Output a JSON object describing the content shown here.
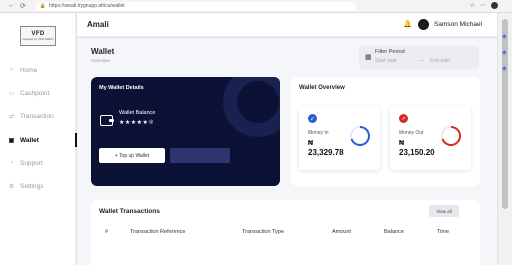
{
  "browser": {
    "url": "https://amali.trygnupp.africa/wallet"
  },
  "logo": {
    "line1": "VFD",
    "line2": "Opened by VFD AMALI"
  },
  "sidebar": {
    "items": [
      {
        "label": "Home",
        "icon": "home-icon"
      },
      {
        "label": "Cashpoint",
        "icon": "cashpoint-icon"
      },
      {
        "label": "Transaction",
        "icon": "transaction-icon"
      },
      {
        "label": "Wallet",
        "icon": "wallet-icon",
        "active": true
      },
      {
        "label": "Support",
        "icon": "support-icon"
      },
      {
        "label": "Settings",
        "icon": "gear-icon"
      }
    ]
  },
  "topbar": {
    "app_name": "Amali",
    "user_name": "Samson Michael"
  },
  "page": {
    "title": "Wallet",
    "breadcrumb": "Overview"
  },
  "filter": {
    "label": "Filter Period",
    "start_placeholder": "Start date",
    "end_placeholder": "End date"
  },
  "wallet_details": {
    "title": "My Wallet Details",
    "balance_label": "Wallet Balance",
    "balance_masked": "★★★★★",
    "topup_label": "+ Top up Wallet"
  },
  "overview": {
    "title": "Wallet Overview",
    "money_in": {
      "label": "Money In",
      "currency": "₦",
      "amount": "23,329.78",
      "color": "#2f5bd3"
    },
    "money_out": {
      "label": "Money Out",
      "currency": "₦",
      "amount": "23,150.20",
      "color": "#d42b2b"
    }
  },
  "transactions": {
    "title": "Wallet Transactions",
    "view_all": "View all",
    "columns": [
      "#",
      "Transaction Reference",
      "Transaction Type",
      "Amount",
      "Balance",
      "Time"
    ]
  }
}
